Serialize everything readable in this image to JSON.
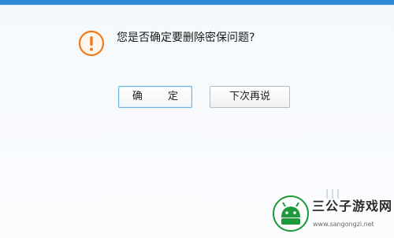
{
  "dialog": {
    "message": "您是否确定要删除密保问题?",
    "warning_icon": "exclamation-circle-icon",
    "buttons": {
      "confirm_label": "确 定",
      "later_label": "下次再说"
    }
  },
  "watermark": {
    "title": "三公子游戏网",
    "url": "www.sangongzi.net",
    "logo_icon": "android-robot-icon"
  },
  "colors": {
    "top_bar": "#2b89d6",
    "warning_orange": "#f07a1c",
    "confirm_border": "#6fb3e3",
    "later_border": "#b8bcc1",
    "logo_green": "#1e9a3c"
  }
}
